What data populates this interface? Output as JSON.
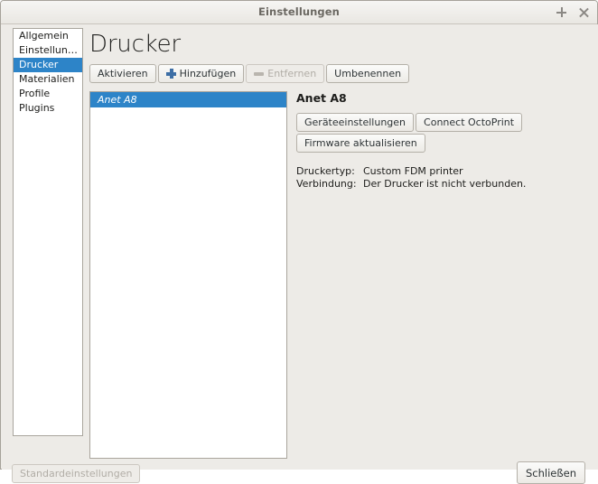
{
  "window": {
    "title": "Einstellungen",
    "controls": [
      {
        "name": "maximize-icon",
        "glyph": "plus"
      },
      {
        "name": "close-icon",
        "glyph": "close"
      }
    ]
  },
  "sidebar": {
    "items": [
      {
        "label": "Allgemein",
        "selected": false
      },
      {
        "label": "Einstellun…",
        "selected": false
      },
      {
        "label": "Drucker",
        "selected": true
      },
      {
        "label": "Materialien",
        "selected": false
      },
      {
        "label": "Profile",
        "selected": false
      },
      {
        "label": "Plugins",
        "selected": false
      }
    ]
  },
  "main": {
    "heading": "Drucker",
    "toolbar": {
      "activate": "Aktivieren",
      "add": "Hinzufügen",
      "remove": "Entfernen",
      "rename": "Umbenennen"
    },
    "printer_list": [
      {
        "name": "Anet A8",
        "selected": true
      }
    ],
    "detail": {
      "title": "Anet A8",
      "buttons": {
        "machine_settings": "Geräteeinstellungen",
        "connect_octoprint": "Connect OctoPrint",
        "update_firmware": "Firmware aktualisieren"
      },
      "info": [
        {
          "key": "Druckertyp:",
          "value": "Custom FDM printer"
        },
        {
          "key": "Verbindung:",
          "value": "Der Drucker ist nicht verbunden."
        }
      ]
    }
  },
  "footer": {
    "defaults": "Standardeinstellungen",
    "close": "Schließen"
  },
  "colors": {
    "selection_blue": "#2d84c8",
    "window_background": "#edebe7",
    "panel_white": "#ffffff",
    "accent_plus": "#3d6ea5",
    "disabled_text": "#b1ada6"
  }
}
